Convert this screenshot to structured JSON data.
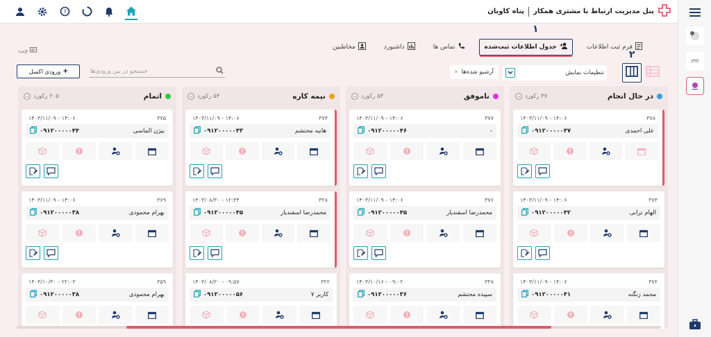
{
  "header": {
    "brand_title": "پنل مدیریت ارتباط با مشتری همکار",
    "company": "پناه کاویان",
    "icons": [
      "user-icon",
      "gear-icon",
      "help-icon",
      "spinner-icon",
      "bell-icon",
      "home-icon"
    ]
  },
  "tabs": [
    {
      "label": "فرم ثبت اطلاعات",
      "icon": "form-icon"
    },
    {
      "label": "جدول اطلاعات ثبت‌شده",
      "icon": "users-icon",
      "active": true
    },
    {
      "label": "تماس ها",
      "icon": "phone-icon"
    },
    {
      "label": "داشبورد",
      "icon": "dashboard-icon"
    },
    {
      "label": "مخاطبین",
      "icon": "contacts-icon"
    }
  ],
  "annotations": {
    "one": "۱",
    "two": "۲"
  },
  "toolbar": {
    "chat_label": "چت",
    "excel_label": "ورودی اکسل",
    "search_placeholder": "جستجو در بین ورودی‌ها",
    "archived_label": "آرشیو شده‌ها",
    "settings_label": "تنظیمات نمایش"
  },
  "columns": [
    {
      "title": "در حال انجام",
      "count": "۳۷ رکورد",
      "color": "#3aa0e0",
      "cards": [
        {
          "id": "۳۷۸",
          "date": "۱۴۰۳/۱۱/۰۹ - ۱۴:۰۶",
          "name": "علی احمدی",
          "phone": "۰۹۱۲۰۰۰۰۰۴۷",
          "marked": true
        },
        {
          "id": "۳۷۳",
          "date": "۱۴۰۳/۱۱/۰۹ - ۱۴:۰۶",
          "name": "الهام ترابی",
          "phone": "۰۹۱۲۰۰۰۰۰۴۲",
          "marked": false
        },
        {
          "id": "۳۷۲",
          "date": "۱۴۰۳/۱۱/۰۹ - ۱۴:۰۶",
          "name": "محمد زنگنه",
          "phone": "۰۹۱۲۰۰۰۰۰۴۱",
          "marked": false
        }
      ]
    },
    {
      "title": "ناموفق",
      "count": "۵۳ رکورد",
      "color": "#d63ad6",
      "cards": [
        {
          "id": "۳۷۷",
          "date": "۱۴۰۳/۱۱/۰۹ - ۱۴:۰۶",
          "name": "-",
          "phone": "۰۹۱۲۰۰۰۰۰۴۶",
          "marked": false
        },
        {
          "id": "۳۷۶",
          "date": "۱۴۰۳/۱۱/۰۹ - ۱۴:۰۶",
          "name": "محمدرضا اسفندیار",
          "phone": "۰۹۱۲۰۰۰۰۰۴۵",
          "marked": false
        },
        {
          "id": "۳۳۸",
          "date": "۱۴۰۳/۱۰/۱۶ - ۰۹:۰۲",
          "name": "سپیده محتشم",
          "phone": "۰۹۱۲۰۰۰۰۰۳۶",
          "marked": false
        }
      ]
    },
    {
      "title": "نیمه کاره",
      "count": "۵۴ رکورد",
      "color": "#f0a020",
      "cards": [
        {
          "id": "۳۷۴",
          "date": "۱۴۰۳/۱۱/۰۹ - ۱۴:۰۶",
          "name": "هانیه محتشم",
          "phone": "۰۹۱۲۰۰۰۰۰۴۳",
          "marked": true
        },
        {
          "id": "۳۲۸",
          "date": "۱۴۰۳/۰۸/۳۰ - ۱۲:۳۴",
          "name": "محمدرضا اسفندیار",
          "phone": "۰۹۱۲۰۰۰۰۰۴۵",
          "marked": true
        },
        {
          "id": "۳۲۲",
          "date": "۱۴۰۳/۰۸/۲۰ - ۰۹:۵۷",
          "name": "کاربر ۷",
          "phone": "۰۹۱۲۰۰۰۰۰۵۶",
          "marked": false
        }
      ]
    },
    {
      "title": "اتمام",
      "count": "۲۰۵ رکورد",
      "color": "#2ecc40",
      "cards": [
        {
          "id": "۳۷۵",
          "date": "۱۴۰۳/۱۱/۰۹ - ۱۴:۰۶",
          "name": "بیژن الماسی",
          "phone": "۰۹۱۲۰۰۰۰۰۴۴",
          "marked": false
        },
        {
          "id": "۳۶۹",
          "date": "۱۴۰۳/۱۱/۰۹ - ۱۴:۰۶",
          "name": "بهرام محمودی",
          "phone": "۰۹۱۲۰۰۰۰۰۳۸",
          "marked": false
        },
        {
          "id": "۳۵۹",
          "date": "۱۴۰۳/۱۰/۳۰ - ۲۲:۰۳",
          "name": "بهرام محمودی",
          "phone": "۰۹۱۲۰۰۰۰۰۳۸",
          "marked": false
        }
      ]
    }
  ]
}
